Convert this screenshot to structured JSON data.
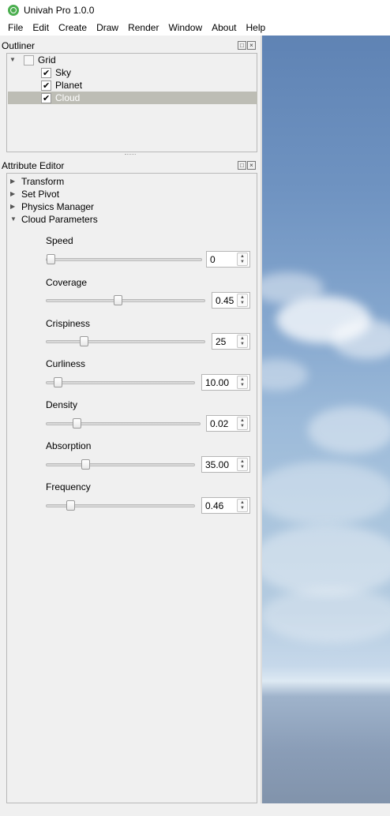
{
  "window": {
    "title": "Univah Pro 1.0.0"
  },
  "menubar": {
    "items": [
      {
        "label": "File"
      },
      {
        "label": "Edit"
      },
      {
        "label": "Create"
      },
      {
        "label": "Draw"
      },
      {
        "label": "Render"
      },
      {
        "label": "Window"
      },
      {
        "label": "About"
      },
      {
        "label": "Help"
      }
    ]
  },
  "outliner": {
    "title": "Outliner",
    "tree": [
      {
        "label": "Grid",
        "checked": false,
        "expanded": true
      },
      {
        "label": "Sky",
        "checked": true
      },
      {
        "label": "Planet",
        "checked": true
      },
      {
        "label": "Cloud",
        "checked": true,
        "selected": true
      }
    ]
  },
  "attribute_editor": {
    "title": "Attribute Editor",
    "sections": [
      {
        "label": "Transform",
        "expanded": false
      },
      {
        "label": "Set Pivot",
        "expanded": false
      },
      {
        "label": "Physics Manager",
        "expanded": false
      },
      {
        "label": "Cloud Parameters",
        "expanded": true
      }
    ],
    "params": [
      {
        "label": "Speed",
        "value": "0",
        "level": 0.0
      },
      {
        "label": "Coverage",
        "value": "0.45",
        "level": 0.45
      },
      {
        "label": "Crispiness",
        "value": "25",
        "level": 0.22
      },
      {
        "label": "Curliness",
        "value": "10.00",
        "level": 0.05
      },
      {
        "label": "Density",
        "value": "0.02",
        "level": 0.18
      },
      {
        "label": "Absorption",
        "value": "35.00",
        "level": 0.25
      },
      {
        "label": "Frequency",
        "value": "0.46",
        "level": 0.14
      }
    ]
  },
  "icons": {
    "app": "univah-logo-icon",
    "dock_float": "float-icon",
    "dock_close": "close-icon",
    "expand": "triangle-down-icon",
    "collapse": "triangle-right-icon"
  },
  "colors": {
    "selection": "#bdbdb5",
    "panel_bg": "#f0f0f0",
    "sky_top": "#5f83b4",
    "horizon": "#dde9f3"
  }
}
